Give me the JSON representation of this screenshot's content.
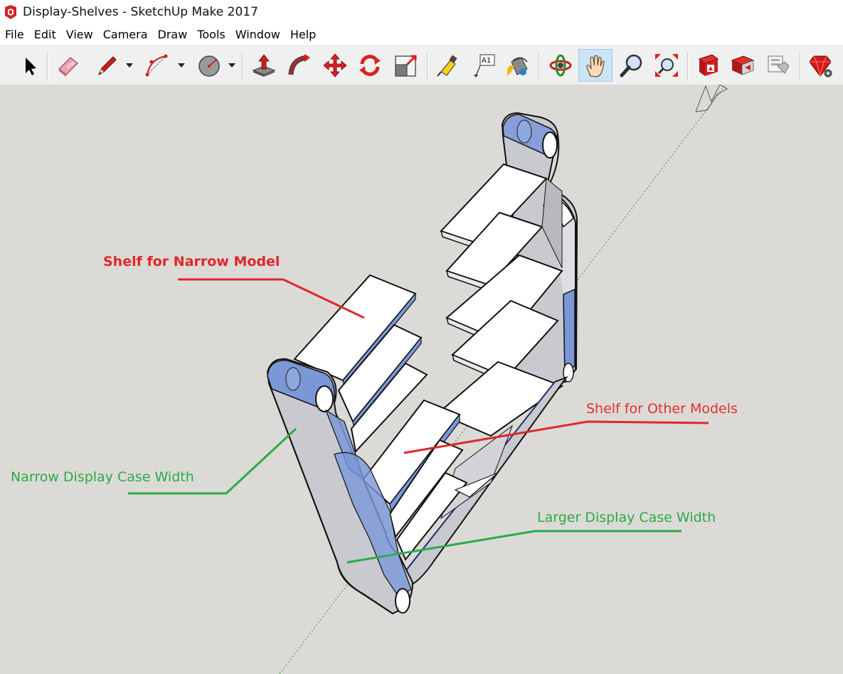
{
  "window": {
    "title": "Display-Shelves - SketchUp Make 2017",
    "icon": "sketchup-logo-icon"
  },
  "menubar": {
    "items": [
      {
        "label": "File"
      },
      {
        "label": "Edit"
      },
      {
        "label": "View"
      },
      {
        "label": "Camera"
      },
      {
        "label": "Draw"
      },
      {
        "label": "Tools"
      },
      {
        "label": "Window"
      },
      {
        "label": "Help"
      }
    ]
  },
  "toolbar": {
    "tools": [
      {
        "name": "select-tool",
        "icon": "arrow-cursor-icon"
      },
      {
        "name": "eraser-tool",
        "icon": "eraser-icon"
      },
      {
        "name": "line-tool",
        "icon": "pencil-icon"
      },
      {
        "name": "arc-tool",
        "icon": "arc-icon"
      },
      {
        "name": "circle-tool",
        "icon": "circle-icon"
      },
      {
        "name": "push-pull-tool",
        "icon": "push-pull-icon"
      },
      {
        "name": "follow-me-tool",
        "icon": "follow-me-icon"
      },
      {
        "name": "move-tool",
        "icon": "move-icon"
      },
      {
        "name": "rotate-tool",
        "icon": "rotate-icon"
      },
      {
        "name": "scale-tool",
        "icon": "scale-icon"
      },
      {
        "name": "tape-measure-tool",
        "icon": "tape-measure-icon"
      },
      {
        "name": "text-tool",
        "icon": "text-label-icon",
        "label": "A1"
      },
      {
        "name": "paint-bucket-tool",
        "icon": "paint-bucket-icon"
      },
      {
        "name": "orbit-tool",
        "icon": "orbit-icon"
      },
      {
        "name": "pan-tool",
        "icon": "hand-icon",
        "active": true
      },
      {
        "name": "zoom-tool",
        "icon": "magnifier-icon"
      },
      {
        "name": "zoom-extents-tool",
        "icon": "zoom-extents-icon"
      },
      {
        "name": "warehouse-tool",
        "icon": "3d-warehouse-icon"
      },
      {
        "name": "share-model-tool",
        "icon": "share-model-icon"
      },
      {
        "name": "extension-warehouse-tool",
        "icon": "extension-warehouse-icon"
      },
      {
        "name": "ruby-console-tool",
        "icon": "ruby-gem-icon"
      }
    ]
  },
  "annotations": {
    "shelf_narrow": "Shelf for Narrow Model",
    "shelf_other": "Shelf for Other Models",
    "narrow_width": "Narrow Display Case Width",
    "larger_width": "Larger Display Case Width"
  },
  "colors": {
    "annotation_red": "#e02828",
    "annotation_green": "#2aac48",
    "viewport_bg": "#dcdad6",
    "model_face": "#d9dbe0",
    "model_selected": "#7f9ee0"
  }
}
